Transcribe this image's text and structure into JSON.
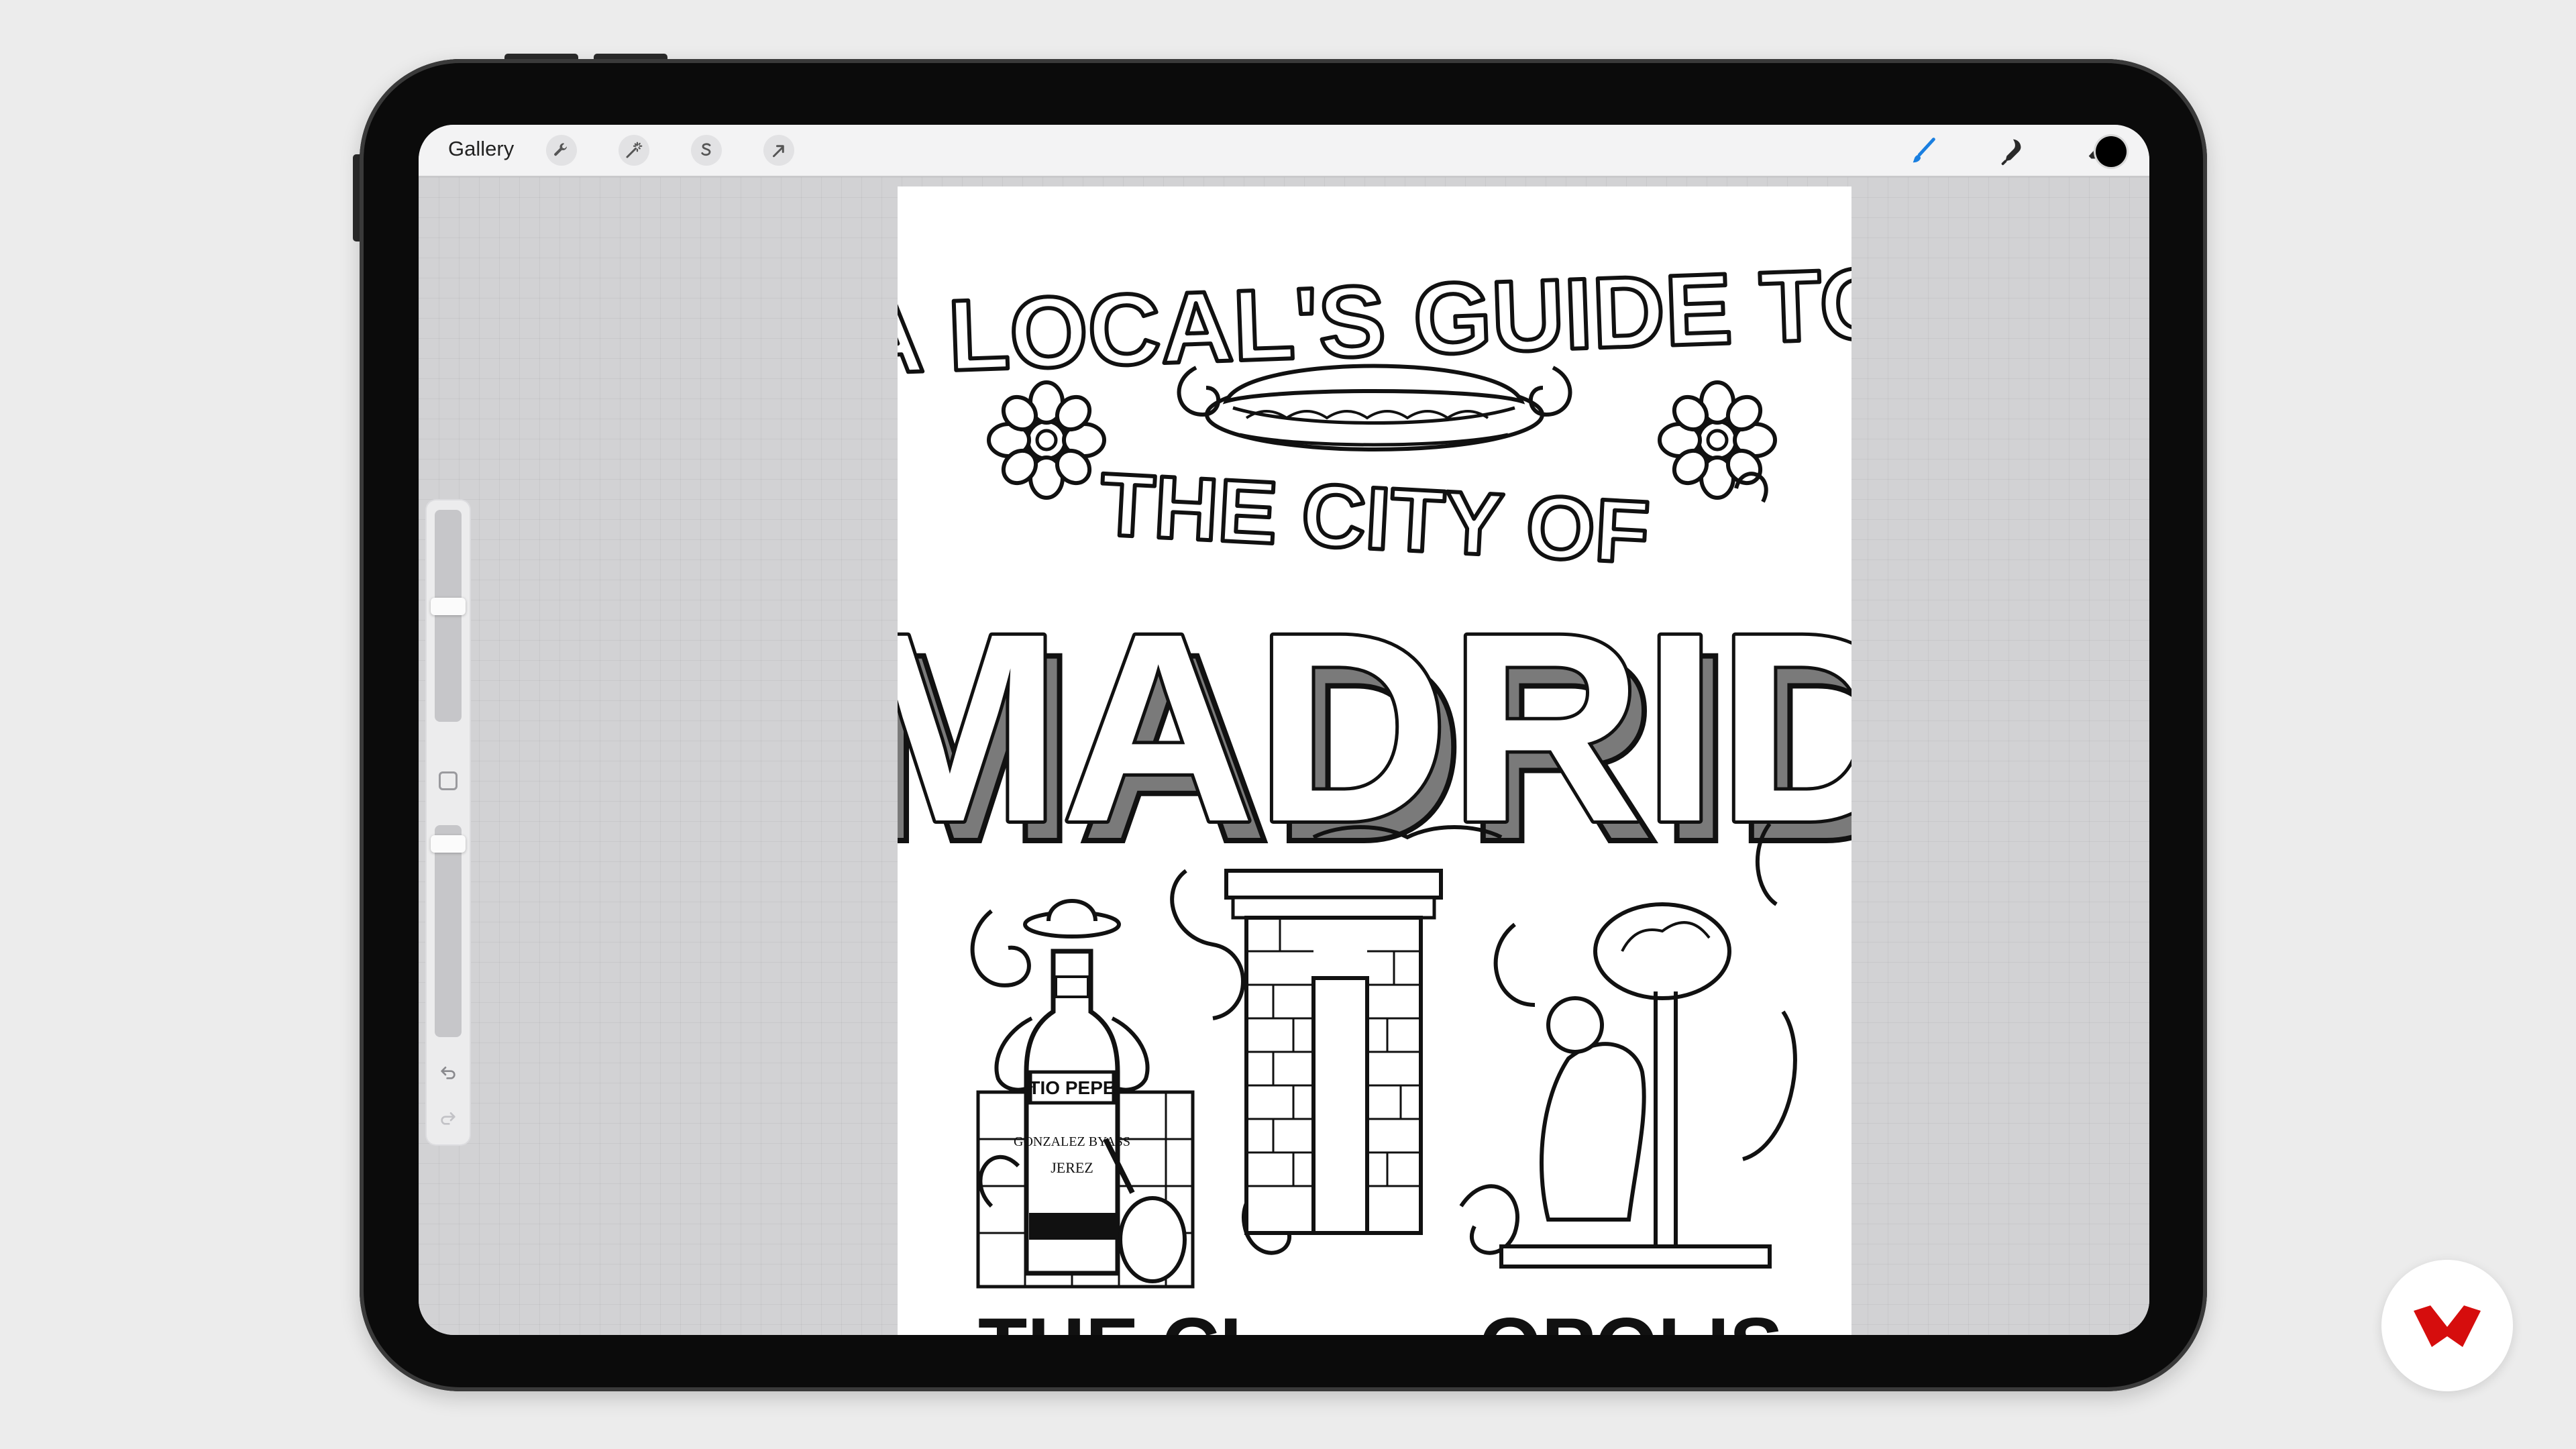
{
  "toolbar": {
    "gallery_label": "Gallery",
    "left_tools": [
      {
        "name": "actions",
        "icon": "wrench-icon"
      },
      {
        "name": "adjustments",
        "icon": "magic-wand-icon"
      },
      {
        "name": "selection",
        "icon": "selection-s-icon"
      },
      {
        "name": "transform",
        "icon": "arrow-cursor-icon"
      }
    ],
    "right_tools": [
      {
        "name": "brush",
        "icon": "brush-icon",
        "active": true
      },
      {
        "name": "smudge",
        "icon": "smudge-icon",
        "active": false
      },
      {
        "name": "eraser",
        "icon": "eraser-icon",
        "active": false
      },
      {
        "name": "layers",
        "icon": "layers-icon",
        "active": false
      }
    ],
    "active_color": "#000000",
    "accent_color": "#1a7fe0"
  },
  "sidebar": {
    "brush_size_level": 0.55,
    "opacity_level": 0.95,
    "undo_icon": "undo-icon",
    "redo_icon": "redo-icon"
  },
  "artwork": {
    "line1": "A LOCAL'S GUIDE TO",
    "line2": "THE CITY OF",
    "line3": "MADRID",
    "bottle_label_top": "TIO PEPE",
    "bottle_label_mid": "GONZALEZ BYASS",
    "bottle_label_bottom": "JEREZ",
    "bottom_left_partial": "THE CI",
    "bottom_right_partial": "OPOLIS"
  },
  "brand": {
    "icon": "brand-logo-icon",
    "color": "#d60d0d"
  }
}
